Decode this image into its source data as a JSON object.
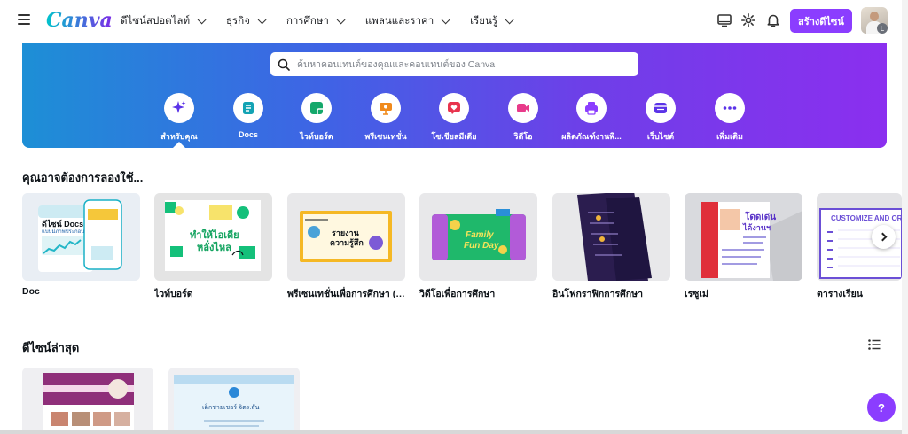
{
  "app": {
    "logo": "Canva"
  },
  "nav": [
    {
      "label": "ดีไซน์สปอตไลท์"
    },
    {
      "label": "ธุรกิจ"
    },
    {
      "label": "การศึกษา"
    },
    {
      "label": "แพลนและราคา"
    },
    {
      "label": "เรียนรู้"
    }
  ],
  "topbar": {
    "create_label": "สร้างดีไซน์",
    "avatar_badge": "L"
  },
  "search": {
    "placeholder": "ค้นหาคอนเทนต์ของคุณและคอนเทนต์ของ Canva"
  },
  "categories": [
    {
      "label": "สำหรับคุณ",
      "icon": "sparkle-icon",
      "color": "#5b33e8"
    },
    {
      "label": "Docs",
      "icon": "doc-icon",
      "color": "#13a3b4"
    },
    {
      "label": "ไวท์บอร์ด",
      "icon": "whiteboard-icon",
      "color": "#14a86b"
    },
    {
      "label": "พรีเซนเทชั่น",
      "icon": "presentation-icon",
      "color": "#f08a1c"
    },
    {
      "label": "โซเชียลมีเดีย",
      "icon": "heart-icon",
      "color": "#e8344e"
    },
    {
      "label": "วิดีโอ",
      "icon": "video-icon",
      "color": "#e83a8a"
    },
    {
      "label": "ผลิตภัณฑ์งานพิ...",
      "icon": "print-icon",
      "color": "#8b3dff"
    },
    {
      "label": "เว็บไซต์",
      "icon": "website-icon",
      "color": "#5b33e8"
    },
    {
      "label": "เพิ่มเติม",
      "icon": "more-icon",
      "color": "#5b33e8"
    }
  ],
  "sections": {
    "try": "คุณอาจต้องการลองใช้...",
    "recent": "ดีไซน์ล่าสุด"
  },
  "templates": [
    {
      "label": "Doc",
      "art": [
        "ดีไซน์ Docs",
        "แบบมีภาพประกอบ"
      ]
    },
    {
      "label": "ไวท์บอร์ด",
      "art": [
        "ทำให้ไอเดีย",
        "หลั่งไหล"
      ]
    },
    {
      "label": "พรีเซนเทชั่นเพื่อการศึกษา (1...",
      "art": [
        "รายงาน",
        "ความรู้สึก"
      ]
    },
    {
      "label": "วิดีโอเพื่อการศึกษา",
      "art": [
        "Family",
        "Fun Day"
      ]
    },
    {
      "label": "อินโฟกราฟิกการศึกษา",
      "art": []
    },
    {
      "label": "เรซูเม่",
      "art": [
        "โดดเด่น",
        "ได้งานฯ"
      ]
    },
    {
      "label": "ตารางเรียน",
      "art": [
        "CUSTOMIZE AND ORG"
      ]
    }
  ],
  "recent": [
    {
      "name": "recent-design-1"
    },
    {
      "name": "recent-design-2",
      "art": "เด็กชายเชอร์ จิตร.สัน"
    }
  ],
  "help": {
    "label": "?"
  },
  "colors": {
    "brand": "#8b3dff",
    "hero_start": "#1d8fd6",
    "hero_end": "#8b2fef"
  }
}
